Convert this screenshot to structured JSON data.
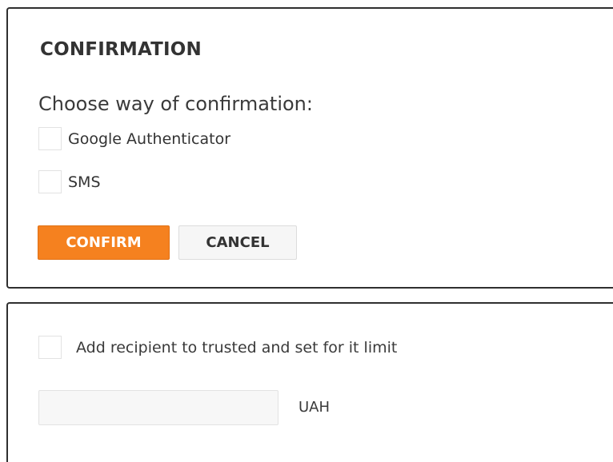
{
  "confirmation": {
    "title": "CONFIRMATION",
    "prompt": "Choose way of confirmation:",
    "options": [
      {
        "label": "Google Authenticator",
        "checked": false
      },
      {
        "label": "SMS",
        "checked": false
      }
    ],
    "confirm_label": "CONFIRM",
    "cancel_label": "CANCEL"
  },
  "trusted": {
    "checkbox_label": "Add recipient to trusted and set for it limit",
    "checked": false,
    "limit_value": "",
    "currency": "UAH"
  },
  "colors": {
    "accent": "#f5811f",
    "border": "#2f2f2f",
    "text": "#333333"
  }
}
